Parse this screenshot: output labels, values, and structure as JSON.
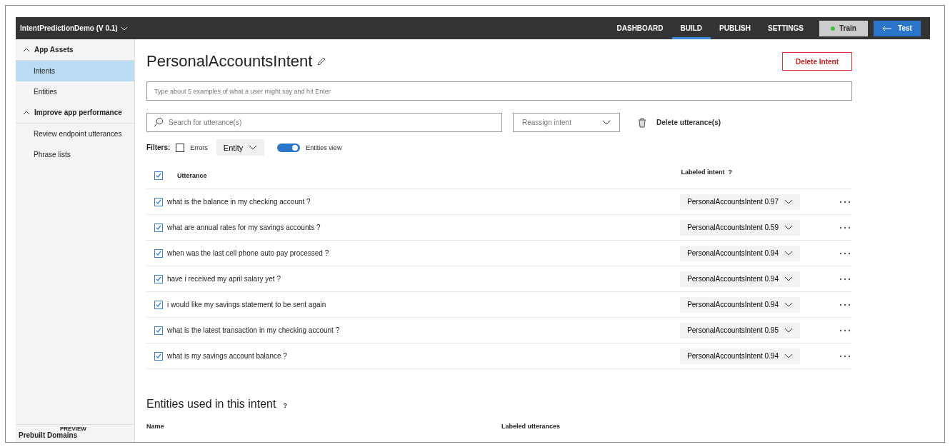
{
  "app_title": "IntentPredictionDemo (V 0.1)",
  "nav": [
    {
      "label": "DASHBOARD",
      "selected": false
    },
    {
      "label": "BUILD",
      "selected": true
    },
    {
      "label": "PUBLISH",
      "selected": false
    },
    {
      "label": "SETTINGS",
      "selected": false
    }
  ],
  "train_button": "Train",
  "test_button": "Test",
  "sidebar": {
    "sections": [
      {
        "label": "App Assets",
        "expanded": true,
        "items": [
          {
            "label": "Intents",
            "selected": true
          },
          {
            "label": "Entities",
            "selected": false
          }
        ]
      },
      {
        "label": "Improve app performance",
        "expanded": true,
        "items": [
          {
            "label": "Review endpoint utterances",
            "selected": false
          },
          {
            "label": "Phrase lists",
            "selected": false
          }
        ]
      }
    ],
    "footer": {
      "label": "Prebuilt Domains",
      "badge": "PREVIEW"
    }
  },
  "intent_title": "PersonalAccountsIntent",
  "delete_intent": "Delete Intent",
  "utterance_input": {
    "placeholder": "Type about 5 examples of what a user might say and hit Enter"
  },
  "search": {
    "placeholder": "Search for utterance(s)"
  },
  "reassign": {
    "placeholder": "Reassign intent"
  },
  "delete_utterances": "Delete utterance(s)",
  "filters": {
    "label": "Filters:",
    "errors": {
      "label": "Errors",
      "checked": false
    },
    "entity": "Entity",
    "entities_view": {
      "label": "Entities view",
      "on": true
    }
  },
  "table": {
    "select_all": true,
    "columns": [
      "Utterance",
      "Labeled intent"
    ],
    "help": "?",
    "rows": [
      {
        "text": "what is the balance in my checking account ?",
        "checked": true,
        "intent": "PersonalAccountsIntent 0.97"
      },
      {
        "text": "what are annual rates for my savings accounts ?",
        "checked": true,
        "intent": "PersonalAccountsIntent 0.59"
      },
      {
        "text": "when was the last cell phone auto pay processed ?",
        "checked": true,
        "intent": "PersonalAccountsIntent 0.94"
      },
      {
        "text": "have i received my april salary yet ?",
        "checked": true,
        "intent": "PersonalAccountsIntent 0.94"
      },
      {
        "text": "i would like my savings statement to be sent again",
        "checked": true,
        "intent": "PersonalAccountsIntent 0.94"
      },
      {
        "text": "what is the latest transaction in my checking account ?",
        "checked": true,
        "intent": "PersonalAccountsIntent 0.95"
      },
      {
        "text": "what is my savings account balance ?",
        "checked": true,
        "intent": "PersonalAccountsIntent 0.94"
      }
    ]
  },
  "entities": {
    "title": "Entities used in this intent",
    "help": "?",
    "columns": [
      "Name",
      "Labeled utterances"
    ]
  }
}
